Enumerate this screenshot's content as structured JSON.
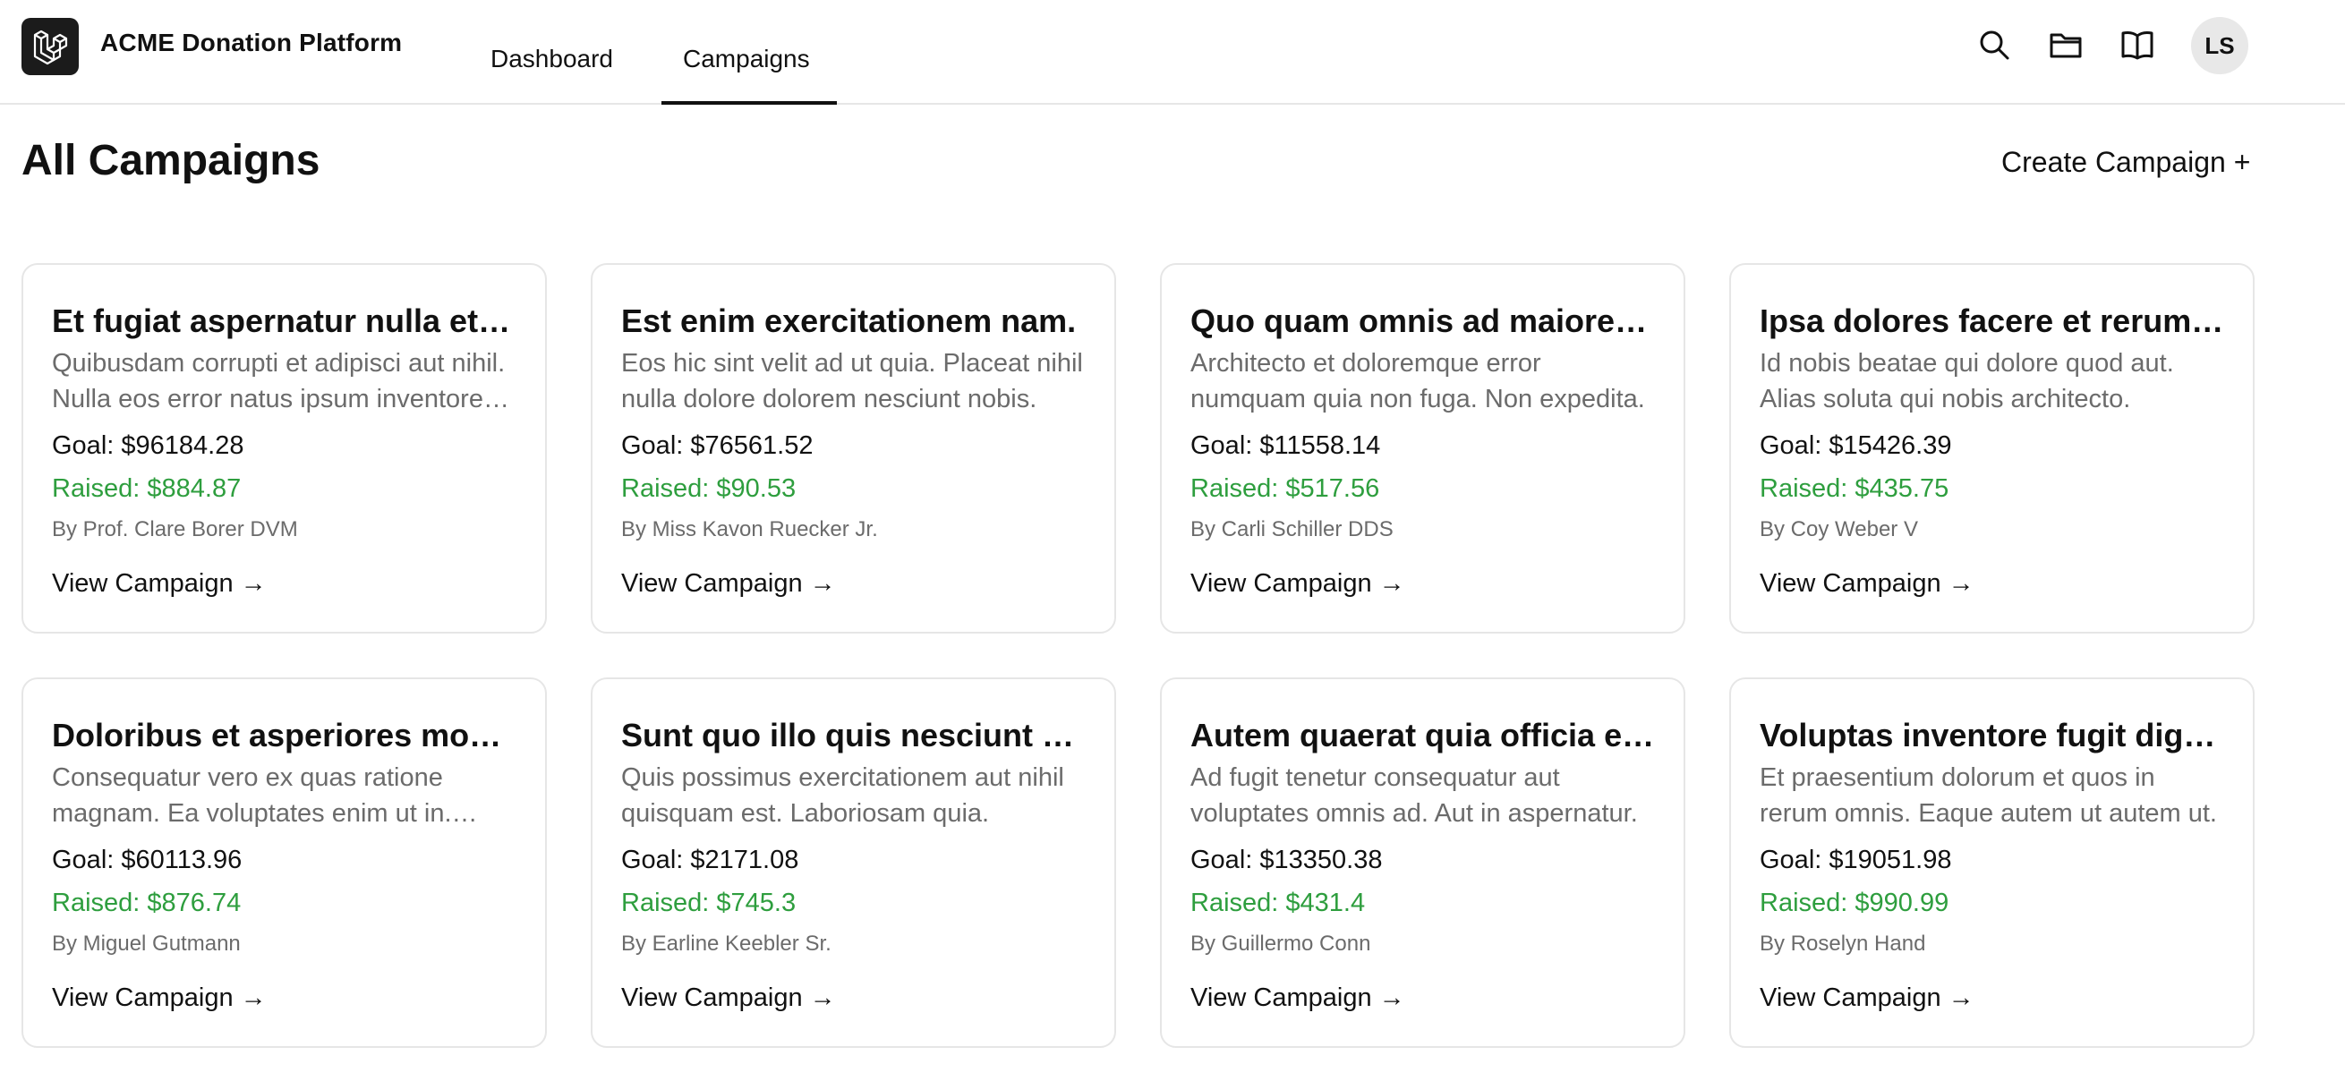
{
  "app": {
    "title": "ACME Donation Platform",
    "logo_icon": "laravel-logo-icon"
  },
  "nav": {
    "tabs": [
      {
        "label": "Dashboard",
        "active": false
      },
      {
        "label": "Campaigns",
        "active": true
      }
    ]
  },
  "header_icons": [
    "search-icon",
    "folder-icon",
    "book-icon"
  ],
  "user": {
    "initials": "LS"
  },
  "page": {
    "title": "All Campaigns",
    "create_label": "Create Campaign +"
  },
  "colors": {
    "raised": "#2e9e3e",
    "logo_bg": "#1b1b1b",
    "avatar_bg": "#e8e8e8"
  },
  "campaigns": [
    {
      "title": "Et fugiat aspernatur nulla et qui.",
      "description": "Quibusdam corrupti et adipisci aut nihil. Nulla eos error natus ipsum inventore ut.",
      "goal": "Goal: $96184.28",
      "raised": "Raised: $884.87",
      "author": "By Prof. Clare Borer DVM",
      "link": "View Campaign →"
    },
    {
      "title": "Est enim exercitationem nam.",
      "description": "Eos hic sint velit ad ut quia. Placeat nihil nulla dolore dolorem nesciunt nobis.",
      "goal": "Goal: $76561.52",
      "raised": "Raised: $90.53",
      "author": "By Miss Kavon Ruecker Jr.",
      "link": "View Campaign →"
    },
    {
      "title": "Quo quam omnis ad maiores et.",
      "description": "Architecto et doloremque error numquam quia non fuga. Non expedita.",
      "goal": "Goal: $11558.14",
      "raised": "Raised: $517.56",
      "author": "By Carli Schiller DDS",
      "link": "View Campaign →"
    },
    {
      "title": "Ipsa dolores facere et rerum et.",
      "description": "Id nobis beatae qui dolore quod aut. Alias soluta qui nobis architecto.",
      "goal": "Goal: $15426.39",
      "raised": "Raised: $435.75",
      "author": "By Coy Weber V",
      "link": "View Campaign →"
    },
    {
      "title": "Doloribus et asperiores modi et.",
      "description": "Consequatur vero ex quas ratione magnam. Ea voluptates enim ut in. Quis.",
      "goal": "Goal: $60113.96",
      "raised": "Raised: $876.74",
      "author": "By Miguel Gutmann",
      "link": "View Campaign →"
    },
    {
      "title": "Sunt quo illo quis nesciunt aut.",
      "description": "Quis possimus exercitationem aut nihil quisquam est. Laboriosam quia.",
      "goal": "Goal: $2171.08",
      "raised": "Raised: $745.3",
      "author": "By Earline Keebler Sr.",
      "link": "View Campaign →"
    },
    {
      "title": "Autem quaerat quia officia error.",
      "description": "Ad fugit tenetur consequatur aut voluptates omnis ad. Aut in aspernatur.",
      "goal": "Goal: $13350.38",
      "raised": "Raised: $431.4",
      "author": "By Guillermo Conn",
      "link": "View Campaign →"
    },
    {
      "title": "Voluptas inventore fugit dignissimos.",
      "description": "Et praesentium dolorum et quos in rerum omnis. Eaque autem ut autem ut.",
      "goal": "Goal: $19051.98",
      "raised": "Raised: $990.99",
      "author": "By Roselyn Hand",
      "link": "View Campaign →"
    }
  ]
}
